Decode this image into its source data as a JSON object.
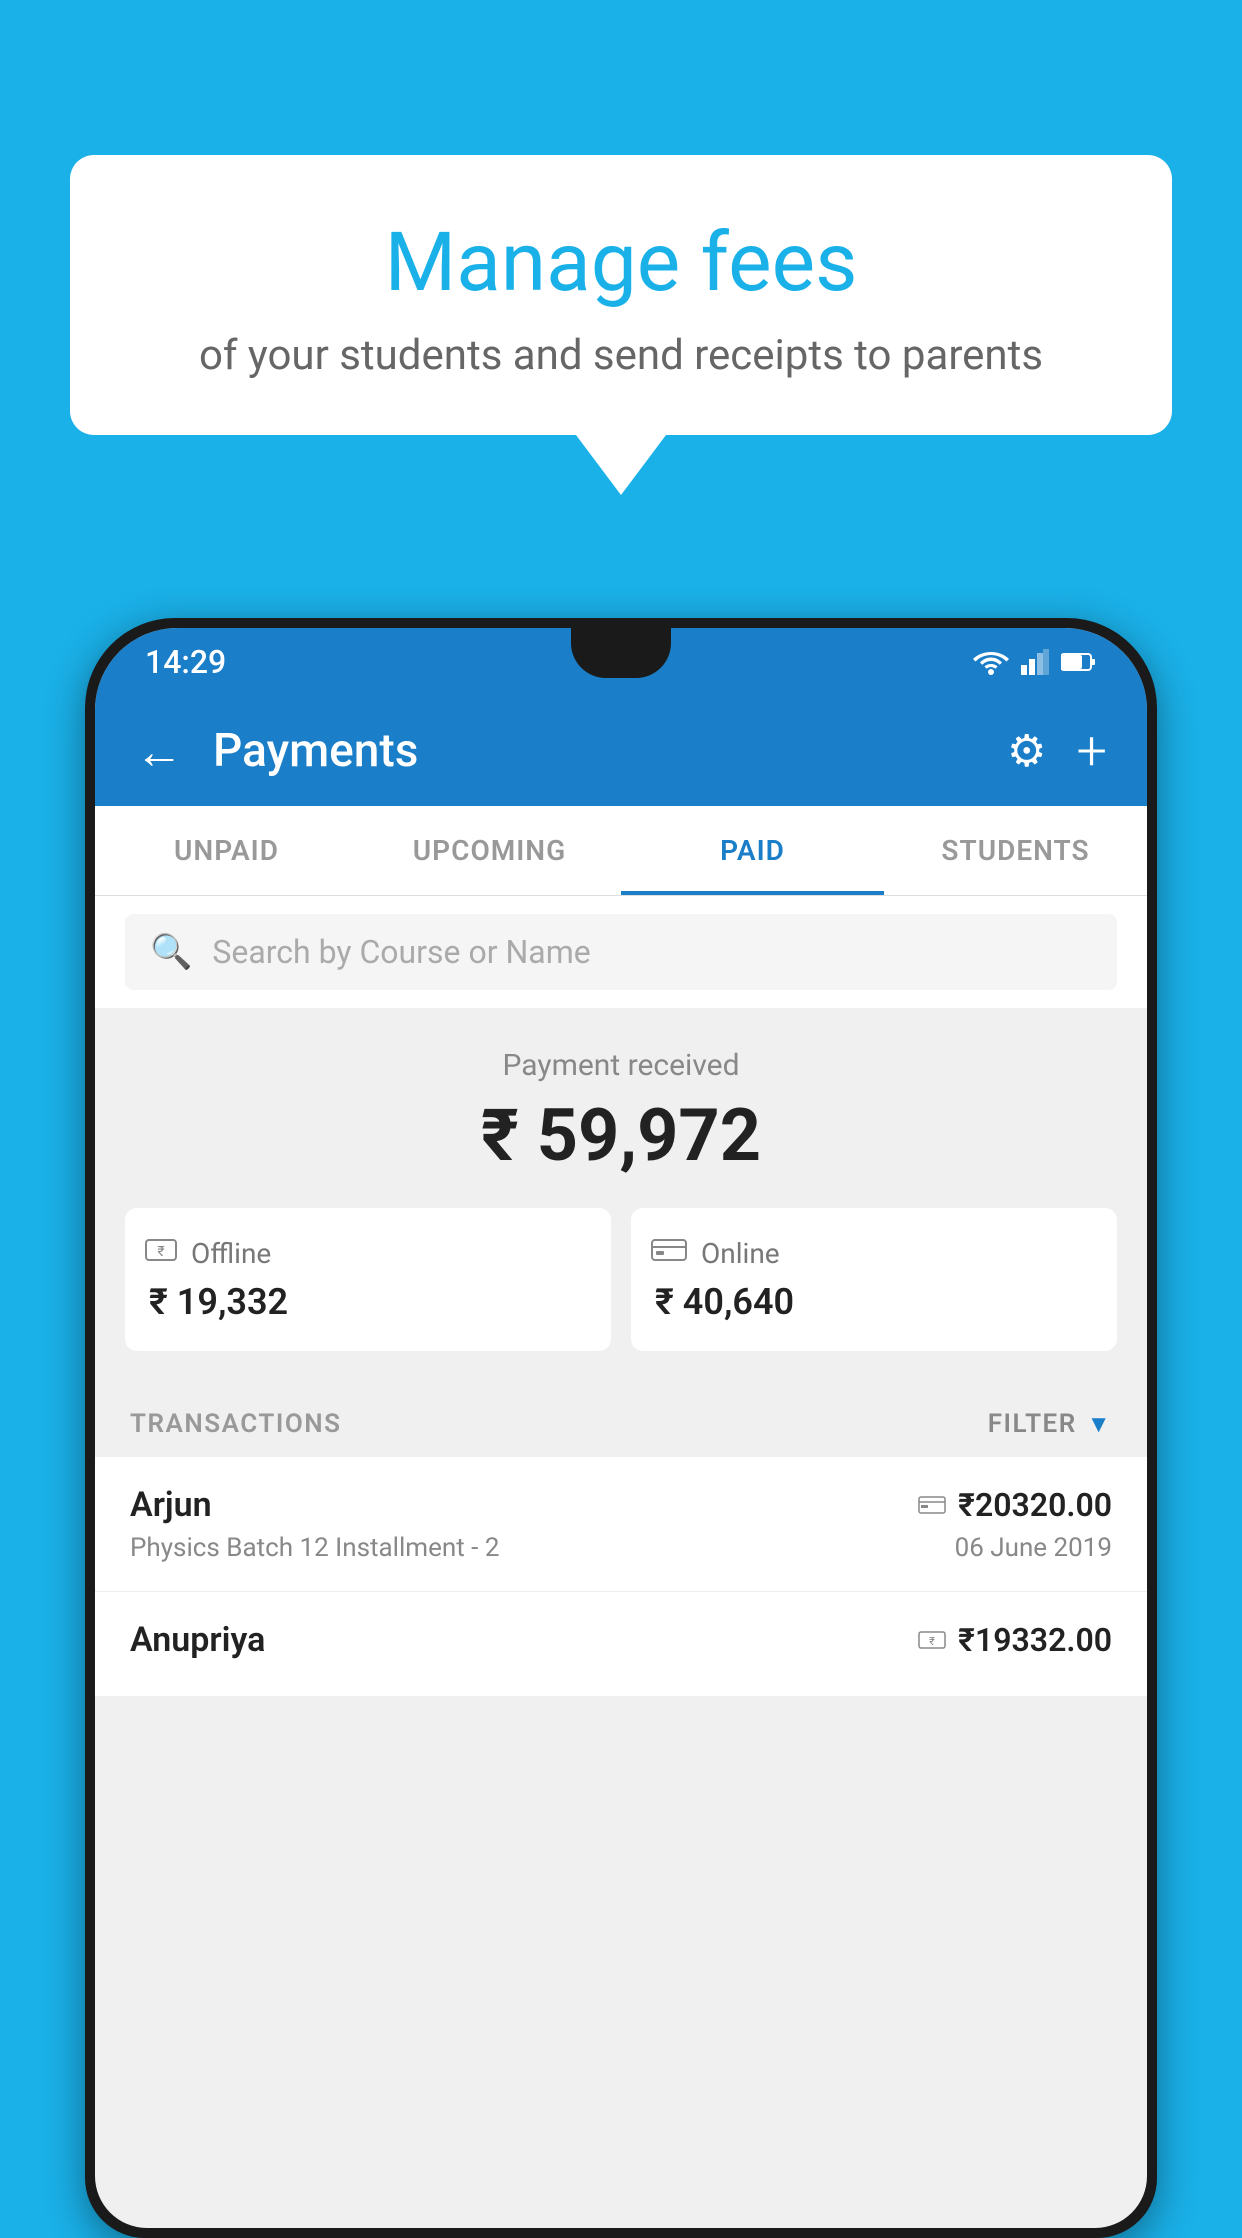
{
  "background": {
    "color": "#1ab0e8"
  },
  "speech_bubble": {
    "title": "Manage fees",
    "subtitle": "of your students and send receipts to parents"
  },
  "status_bar": {
    "time": "14:29",
    "color": "#1a7ec8"
  },
  "app_bar": {
    "title": "Payments",
    "back_label": "←",
    "settings_label": "⚙",
    "add_label": "+"
  },
  "tabs": [
    {
      "label": "UNPAID",
      "active": false
    },
    {
      "label": "UPCOMING",
      "active": false
    },
    {
      "label": "PAID",
      "active": true
    },
    {
      "label": "STUDENTS",
      "active": false
    }
  ],
  "search": {
    "placeholder": "Search by Course or Name"
  },
  "payment_summary": {
    "label": "Payment received",
    "total": "₹ 59,972",
    "offline": {
      "label": "Offline",
      "amount": "₹ 19,332"
    },
    "online": {
      "label": "Online",
      "amount": "₹ 40,640"
    }
  },
  "transactions_section": {
    "header": "TRANSACTIONS",
    "filter": "FILTER"
  },
  "transactions": [
    {
      "name": "Arjun",
      "detail": "Physics Batch 12 Installment - 2",
      "amount": "₹20320.00",
      "date": "06 June 2019",
      "payment_type": "online"
    },
    {
      "name": "Anupriya",
      "detail": "",
      "amount": "₹19332.00",
      "date": "",
      "payment_type": "offline"
    }
  ]
}
